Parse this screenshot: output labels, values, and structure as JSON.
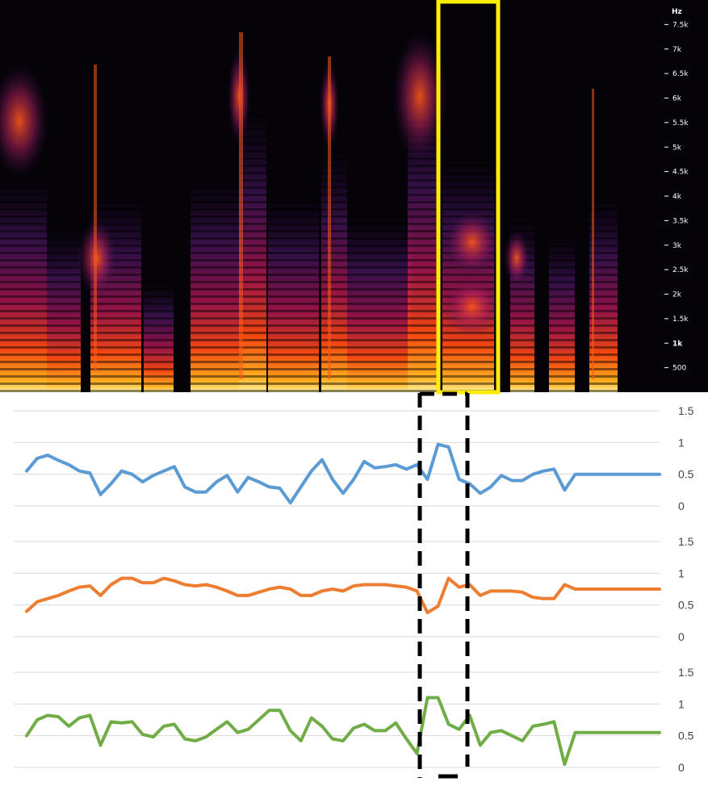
{
  "colors": {
    "spec_bg": "#050308",
    "highlight": "#ffee00",
    "guide": "#000000",
    "grid": "#d9d9d9",
    "series": [
      "#5b9bd5",
      "#ed7d31",
      "#70ad47"
    ]
  },
  "spectrogram": {
    "unit_label": "Hz",
    "freq_ticks": [
      {
        "label": "7.5k",
        "hz": 7500
      },
      {
        "label": "7k",
        "hz": 7000
      },
      {
        "label": "6.5k",
        "hz": 6500
      },
      {
        "label": "6k",
        "hz": 6000
      },
      {
        "label": "5.5k",
        "hz": 5500
      },
      {
        "label": "5k",
        "hz": 5000
      },
      {
        "label": "4.5k",
        "hz": 4500
      },
      {
        "label": "4k",
        "hz": 4000
      },
      {
        "label": "3.5k",
        "hz": 3500
      },
      {
        "label": "3k",
        "hz": 3000
      },
      {
        "label": "2.5k",
        "hz": 2500
      },
      {
        "label": "2k",
        "hz": 2000
      },
      {
        "label": "1.5k",
        "hz": 1500
      },
      {
        "label": "1k",
        "hz": 1000
      },
      {
        "label": "500",
        "hz": 500
      }
    ],
    "bold_ticks": [
      "1k"
    ],
    "max_hz": 8000
  },
  "chart_data": [
    {
      "type": "line",
      "ylim": [
        0,
        1.5
      ],
      "yticks": [
        "1.5",
        "1",
        "0.5",
        "0"
      ],
      "grid": true,
      "series": [
        {
          "values": [
            0.55,
            0.75,
            0.8,
            0.72,
            0.65,
            0.55,
            0.52,
            0.18,
            0.35,
            0.55,
            0.5,
            0.38,
            0.48,
            0.55,
            0.62,
            0.3,
            0.22,
            0.22,
            0.38,
            0.48,
            0.22,
            0.45,
            0.38,
            0.3,
            0.28,
            0.05,
            0.3,
            0.55,
            0.73,
            0.42,
            0.2,
            0.42,
            0.7,
            0.6,
            0.62,
            0.65,
            0.58,
            0.65,
            0.42,
            0.97,
            0.93,
            0.42,
            0.35,
            0.2,
            0.3,
            0.48,
            0.4,
            0.4,
            0.5,
            0.55,
            0.58,
            0.25,
            0.5,
            0.5,
            0.5,
            0.5,
            0.5,
            0.5,
            0.5,
            0.5,
            0.5
          ]
        }
      ]
    },
    {
      "type": "line",
      "ylim": [
        0,
        1.5
      ],
      "yticks": [
        "1.5",
        "1",
        "0.5",
        "0"
      ],
      "grid": true,
      "series": [
        {
          "values": [
            0.4,
            0.55,
            0.6,
            0.65,
            0.72,
            0.78,
            0.8,
            0.65,
            0.82,
            0.92,
            0.92,
            0.85,
            0.85,
            0.92,
            0.88,
            0.82,
            0.8,
            0.82,
            0.78,
            0.72,
            0.65,
            0.65,
            0.7,
            0.75,
            0.78,
            0.75,
            0.65,
            0.65,
            0.72,
            0.75,
            0.72,
            0.8,
            0.82,
            0.82,
            0.82,
            0.8,
            0.78,
            0.72,
            0.38,
            0.48,
            0.92,
            0.78,
            0.82,
            0.65,
            0.72,
            0.72,
            0.72,
            0.7,
            0.62,
            0.6,
            0.6,
            0.82,
            0.75,
            0.75,
            0.75,
            0.75,
            0.75,
            0.75,
            0.75,
            0.75,
            0.75
          ]
        }
      ]
    },
    {
      "type": "line",
      "ylim": [
        0,
        1.5
      ],
      "yticks": [
        "1.5",
        "1",
        "0.5",
        "0"
      ],
      "grid": true,
      "series": [
        {
          "values": [
            0.5,
            0.75,
            0.82,
            0.8,
            0.65,
            0.78,
            0.82,
            0.35,
            0.72,
            0.7,
            0.72,
            0.52,
            0.48,
            0.65,
            0.68,
            0.45,
            0.42,
            0.48,
            0.6,
            0.72,
            0.55,
            0.6,
            0.75,
            0.9,
            0.9,
            0.58,
            0.42,
            0.78,
            0.65,
            0.45,
            0.42,
            0.62,
            0.68,
            0.58,
            0.58,
            0.7,
            0.45,
            0.22,
            1.1,
            1.1,
            0.68,
            0.6,
            0.82,
            0.35,
            0.55,
            0.58,
            0.5,
            0.42,
            0.65,
            0.68,
            0.72,
            0.05,
            0.55,
            0.55,
            0.55,
            0.55,
            0.55,
            0.55,
            0.55,
            0.55,
            0.55
          ]
        }
      ]
    }
  ]
}
